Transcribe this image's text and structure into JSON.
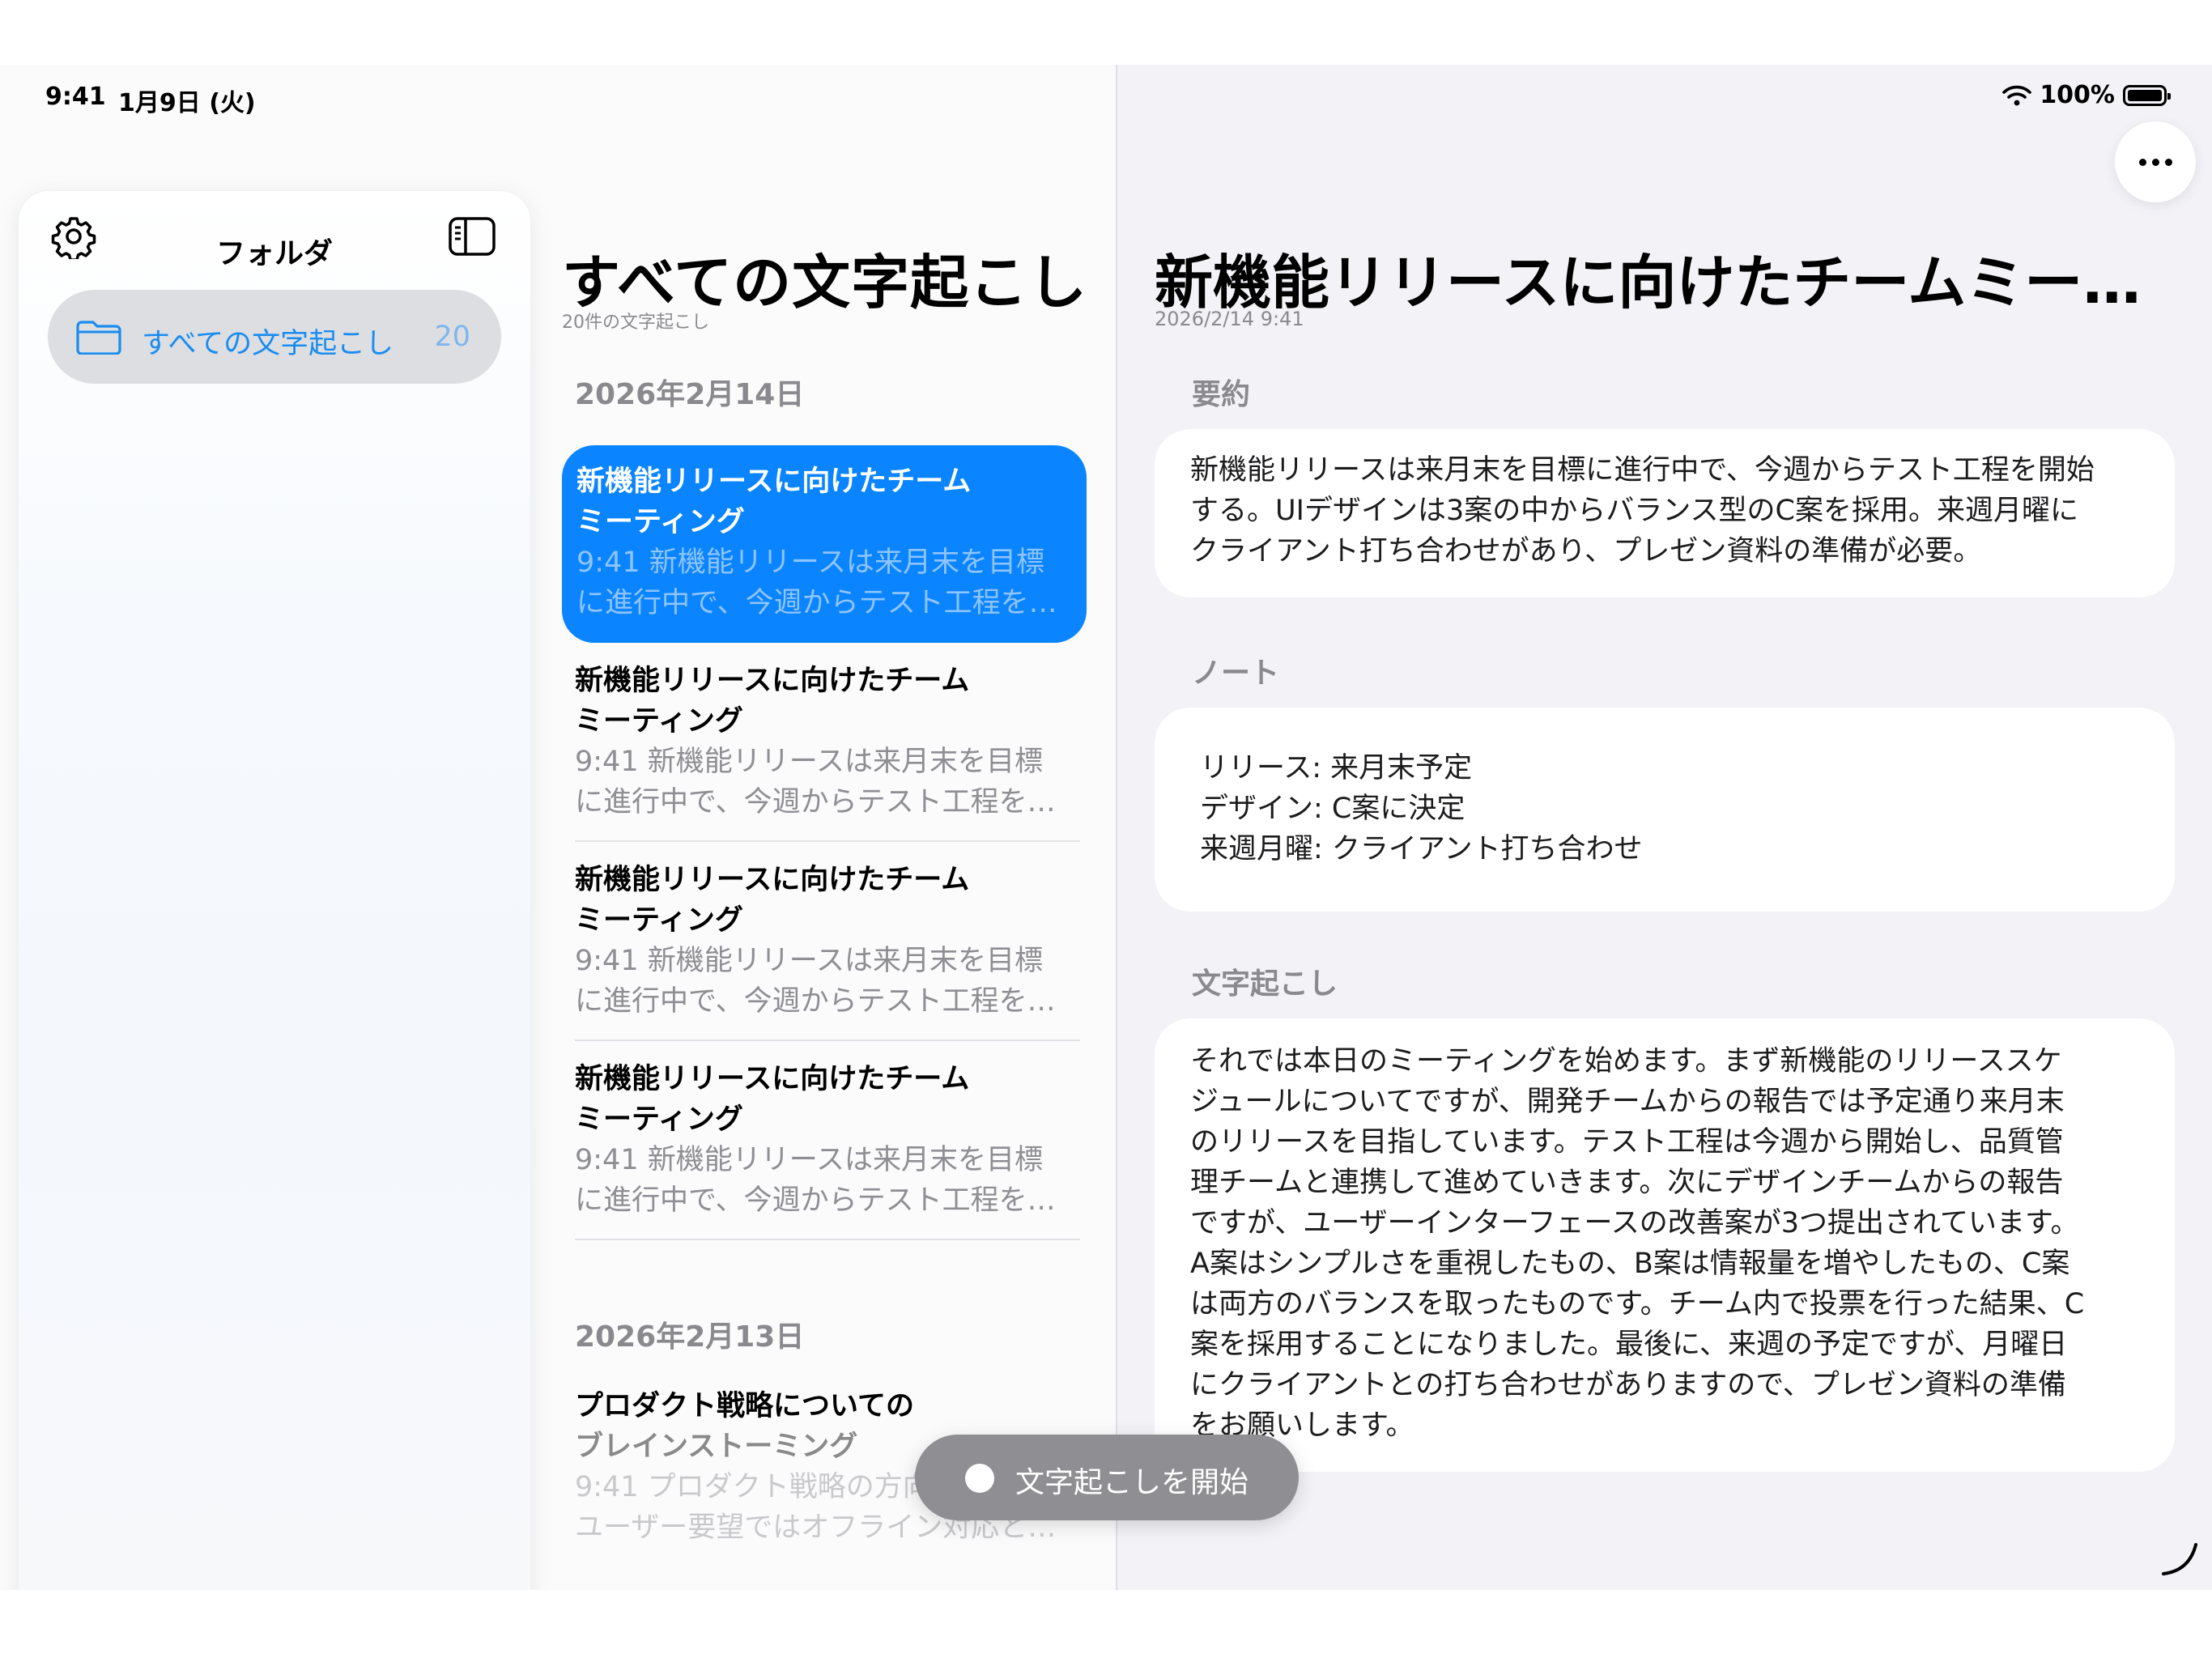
{
  "status_bar": {
    "time": "9:41",
    "date": "1月9日 (火)",
    "battery": "100%"
  },
  "sidebar": {
    "title": "フォルダ",
    "folders": [
      {
        "label": "すべての文字起こし",
        "count": "20"
      }
    ]
  },
  "list": {
    "title": "すべての文字起こし",
    "subtitle": "20件の文字起こし",
    "groups": [
      {
        "date": "2026年2月14日",
        "items": [
          {
            "title_line1": "新機能リリースに向けたチーム",
            "title_line2": "ミーティング",
            "preview_line1": "9:41 新機能リリースは来月末を目標",
            "preview_line2": "に進行中で、今週からテスト工程を…"
          },
          {
            "title_line1": "新機能リリースに向けたチーム",
            "title_line2": "ミーティング",
            "preview_line1": "9:41 新機能リリースは来月末を目標",
            "preview_line2": "に進行中で、今週からテスト工程を…"
          },
          {
            "title_line1": "新機能リリースに向けたチーム",
            "title_line2": "ミーティング",
            "preview_line1": "9:41 新機能リリースは来月末を目標",
            "preview_line2": "に進行中で、今週からテスト工程を…"
          },
          {
            "title_line1": "新機能リリースに向けたチーム",
            "title_line2": "ミーティング",
            "preview_line1": "9:41 新機能リリースは来月末を目標",
            "preview_line2": "に進行中で、今週からテスト工程を…"
          }
        ]
      },
      {
        "date": "2026年2月13日",
        "items": [
          {
            "title_line1": "プロダクト戦略についての",
            "title_line2": "ブレインストーミング",
            "preview_line1": "9:41 プロダクト戦略の方向",
            "preview_line2": "ユーザー要望ではオフライン対応と…"
          }
        ]
      }
    ]
  },
  "detail": {
    "title": "新機能リリースに向けたチームミー…",
    "date": "2026/2/14 9:41",
    "summary_label": "要約",
    "summary_lines": [
      "新機能リリースは来月末を目標に進行中で、今週からテスト工程を開始",
      "する。UIデザインは3案の中からバランス型のC案を採用。来週月曜に",
      "クライアント打ち合わせがあり、プレゼン資料の準備が必要。"
    ],
    "notes_label": "ノート",
    "notes_lines": [
      "リリース: 来月末予定",
      "デザイン: C案に決定",
      "来週月曜: クライアント打ち合わせ"
    ],
    "transcript_label": "文字起こし",
    "transcript_lines": [
      "それでは本日のミーティングを始めます。まず新機能のリリーススケ",
      "ジュールについてですが、開発チームからの報告では予定通り来月末",
      "のリリースを目指しています。テスト工程は今週から開始し、品質管",
      "理チームと連携して進めていきます。次にデザインチームからの報告",
      "ですが、ユーザーインターフェースの改善案が3つ提出されています。",
      "A案はシンプルさを重視したもの、B案は情報量を増やしたもの、C案",
      "は両方のバランスを取ったものです。チーム内で投票を行った結果、C",
      "案を採用することになりました。最後に、来週の予定ですが、月曜日",
      "にクライアントとの打ち合わせがありますので、プレゼン資料の準備",
      "をお願いします。"
    ]
  },
  "start_button": {
    "label": "文字起こしを開始"
  }
}
